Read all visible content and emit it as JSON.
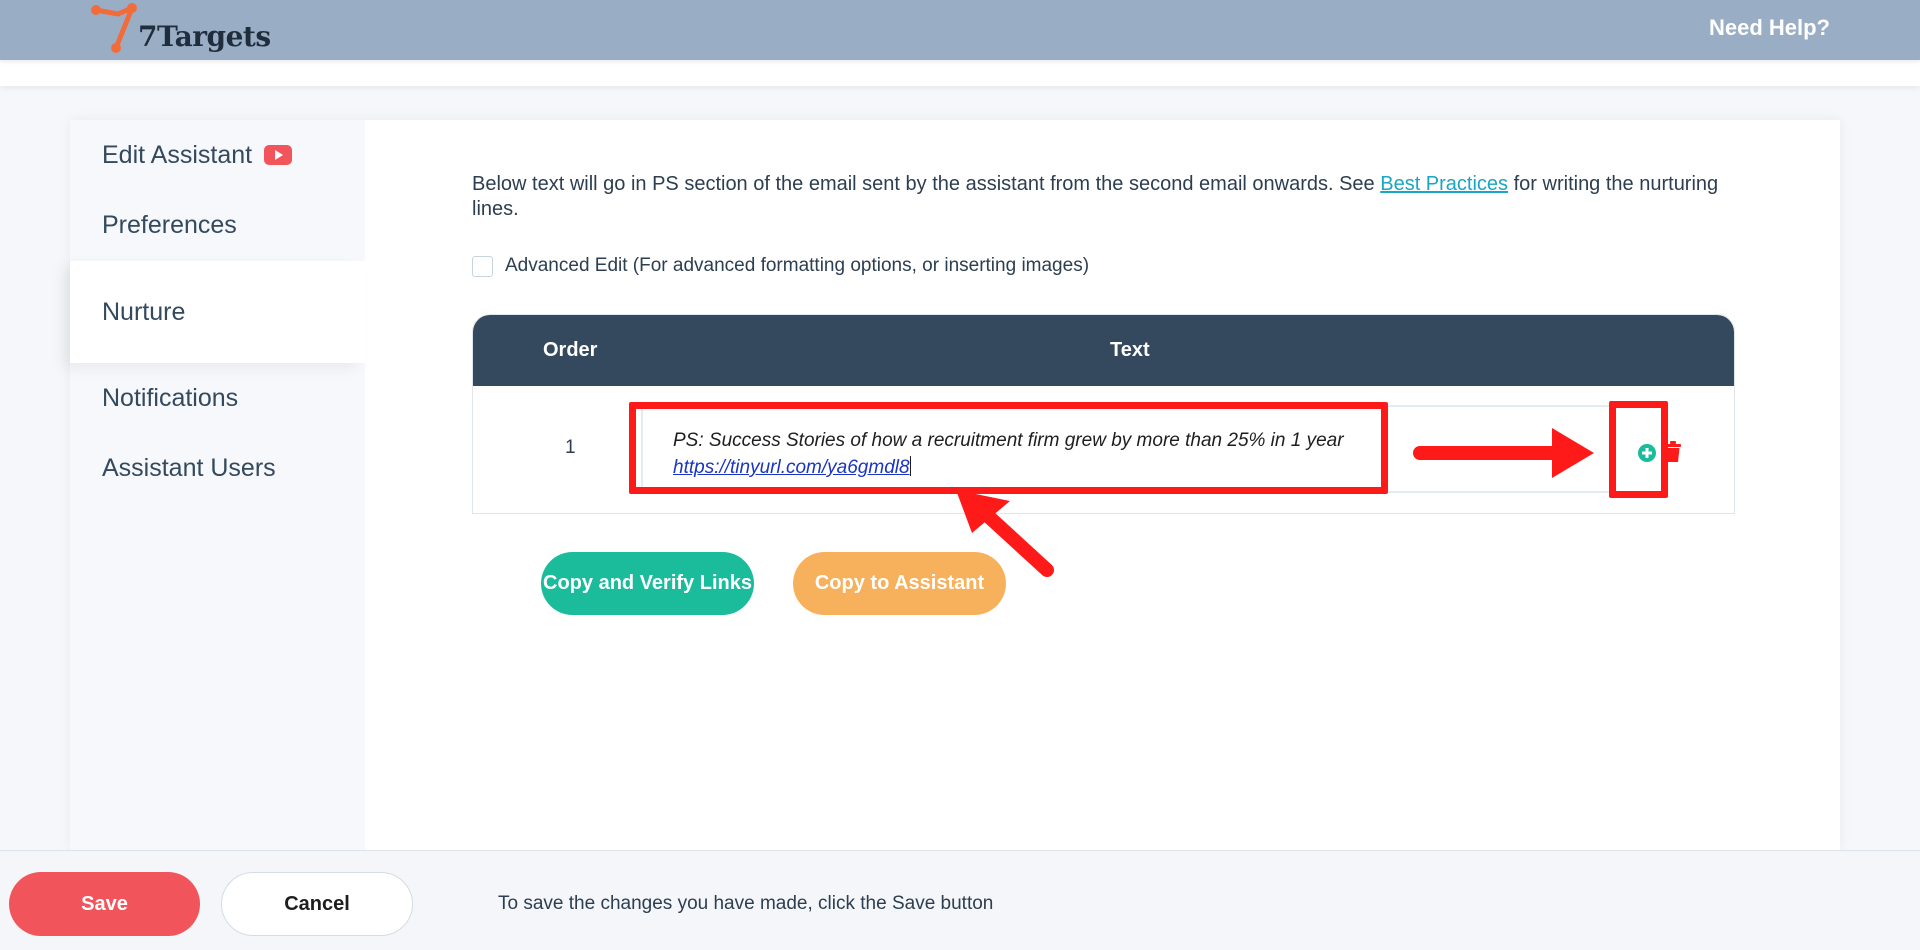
{
  "header": {
    "logo_text": "7Targets",
    "help_label": "Need Help?"
  },
  "sidebar": {
    "items": [
      {
        "label": "Edit Assistant",
        "icon": "youtube-icon"
      },
      {
        "label": "Preferences"
      },
      {
        "label": "Nurture",
        "active": true
      },
      {
        "label": "Notifications"
      },
      {
        "label": "Assistant Users"
      }
    ]
  },
  "main": {
    "intro_before_link": "Below text will go in PS section of the email sent by the assistant from the second email onwards. See ",
    "intro_link": "Best Practices",
    "intro_after_link": " for writing the nurturing lines.",
    "advanced_edit_label": "Advanced Edit (For advanced formatting options, or inserting images)",
    "advanced_edit_checked": false,
    "table": {
      "headers": [
        "Order",
        "Text"
      ],
      "rows": [
        {
          "order": "1",
          "text": "PS: Success Stories of how a recruitment firm grew by more than 25% in 1 year",
          "link": "https://tinyurl.com/ya6gmdl8"
        }
      ]
    },
    "verify_button_label": "Copy and Verify Links",
    "copy_button_label": "Copy to Assistant"
  },
  "footer": {
    "save_label": "Save",
    "cancel_label": "Cancel",
    "hint": "To save the changes you have made, click the Save button"
  },
  "colors": {
    "header_bg": "#99aec5",
    "table_header": "#34495e",
    "teal": "#1abc9c",
    "orange": "#f7b15c",
    "save_red": "#f2545b",
    "annotation_red": "#ff1a1a",
    "link": "#1aa5c4"
  }
}
